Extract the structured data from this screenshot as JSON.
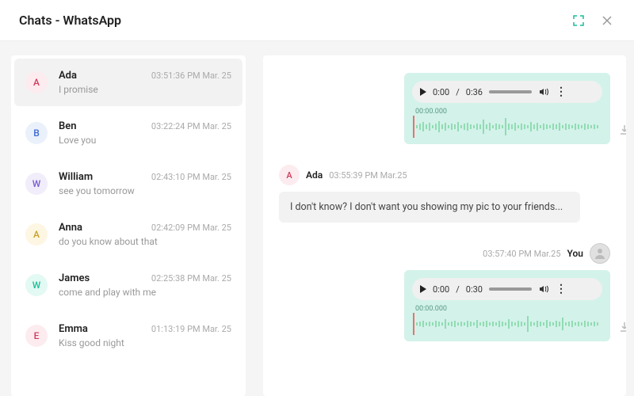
{
  "header": {
    "title": "Chats - WhatsApp"
  },
  "chats": [
    {
      "initial": "A",
      "name": "Ada",
      "preview": "I promise",
      "time": "03:51:36 PM Mar. 25",
      "avClass": "av-a",
      "selected": true
    },
    {
      "initial": "B",
      "name": "Ben",
      "preview": "Love you",
      "time": "03:22:24 PM Mar. 25",
      "avClass": "av-b",
      "selected": false
    },
    {
      "initial": "W",
      "name": "William",
      "preview": "see you tomorrow",
      "time": "02:43:10 PM Mar. 25",
      "avClass": "av-w",
      "selected": false
    },
    {
      "initial": "A",
      "name": "Anna",
      "preview": "do you know about that",
      "time": "02:42:09 PM Mar. 25",
      "avClass": "av-an",
      "selected": false
    },
    {
      "initial": "W",
      "name": "James",
      "preview": "come and play with me",
      "time": "02:25:38 PM Mar. 25",
      "avClass": "av-j",
      "selected": false
    },
    {
      "initial": "E",
      "name": "Emma",
      "preview": "Kiss good night",
      "time": "01:13:19 PM Mar. 25",
      "avClass": "av-e",
      "selected": false
    }
  ],
  "conversation": {
    "voice_in": {
      "current": "0:00",
      "total": "0:36",
      "waveform_time": "00:00.000"
    },
    "meta_in": {
      "initial": "A",
      "name": "Ada",
      "time": "03:55:39 PM Mar.25"
    },
    "text_in": "I don't know? I don't want you showing my pic to your friends...",
    "meta_out": {
      "name": "You",
      "time": "03:57:40 PM Mar.25"
    },
    "voice_out": {
      "current": "0:00",
      "total": "0:30",
      "waveform_time": "00:00.000"
    }
  }
}
